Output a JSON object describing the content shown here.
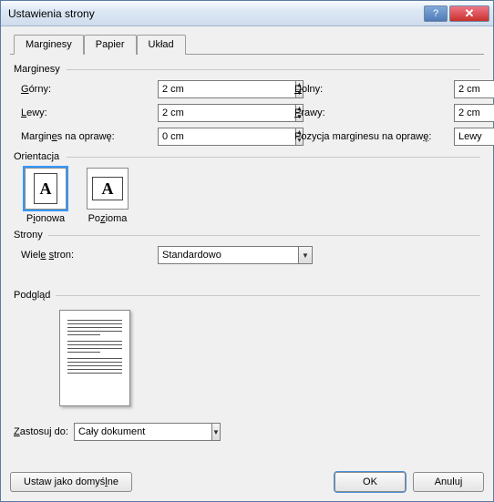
{
  "window": {
    "title": "Ustawienia strony"
  },
  "tabs": {
    "t0": "Marginesy",
    "t1": "Papier",
    "t2": "Układ"
  },
  "groups": {
    "margins": "Marginesy",
    "orient": "Orientacja",
    "pages": "Strony",
    "preview": "Podgląd"
  },
  "labels": {
    "top": "Górny:",
    "top_u": "G",
    "bottom": "Dolny:",
    "bottom_u": "D",
    "left": "Lewy:",
    "left_u": "L",
    "right": "Prawy:",
    "right_u": "P",
    "gutter": "Margines na oprawę:",
    "gutter_u": "e",
    "gutter_pos": "Pozycja marginesu na oprawę:",
    "gutter_pos_u": "ę",
    "multi": "Wiele stron:",
    "multi_u": "s",
    "apply": "Zastosuj do:",
    "apply_u": "Z",
    "portrait": "Pionowa",
    "portrait_u": "i",
    "landscape": "Pozioma",
    "landscape_u": "z"
  },
  "values": {
    "top": "2 cm",
    "bottom": "2 cm",
    "left": "2 cm",
    "right": "2 cm",
    "gutter": "0 cm",
    "gutter_pos": "Lewy",
    "multi": "Standardowo",
    "apply": "Cały dokument"
  },
  "buttons": {
    "default": "Ustaw jako domyślne",
    "default_u": "l",
    "ok": "OK",
    "cancel": "Anuluj"
  }
}
